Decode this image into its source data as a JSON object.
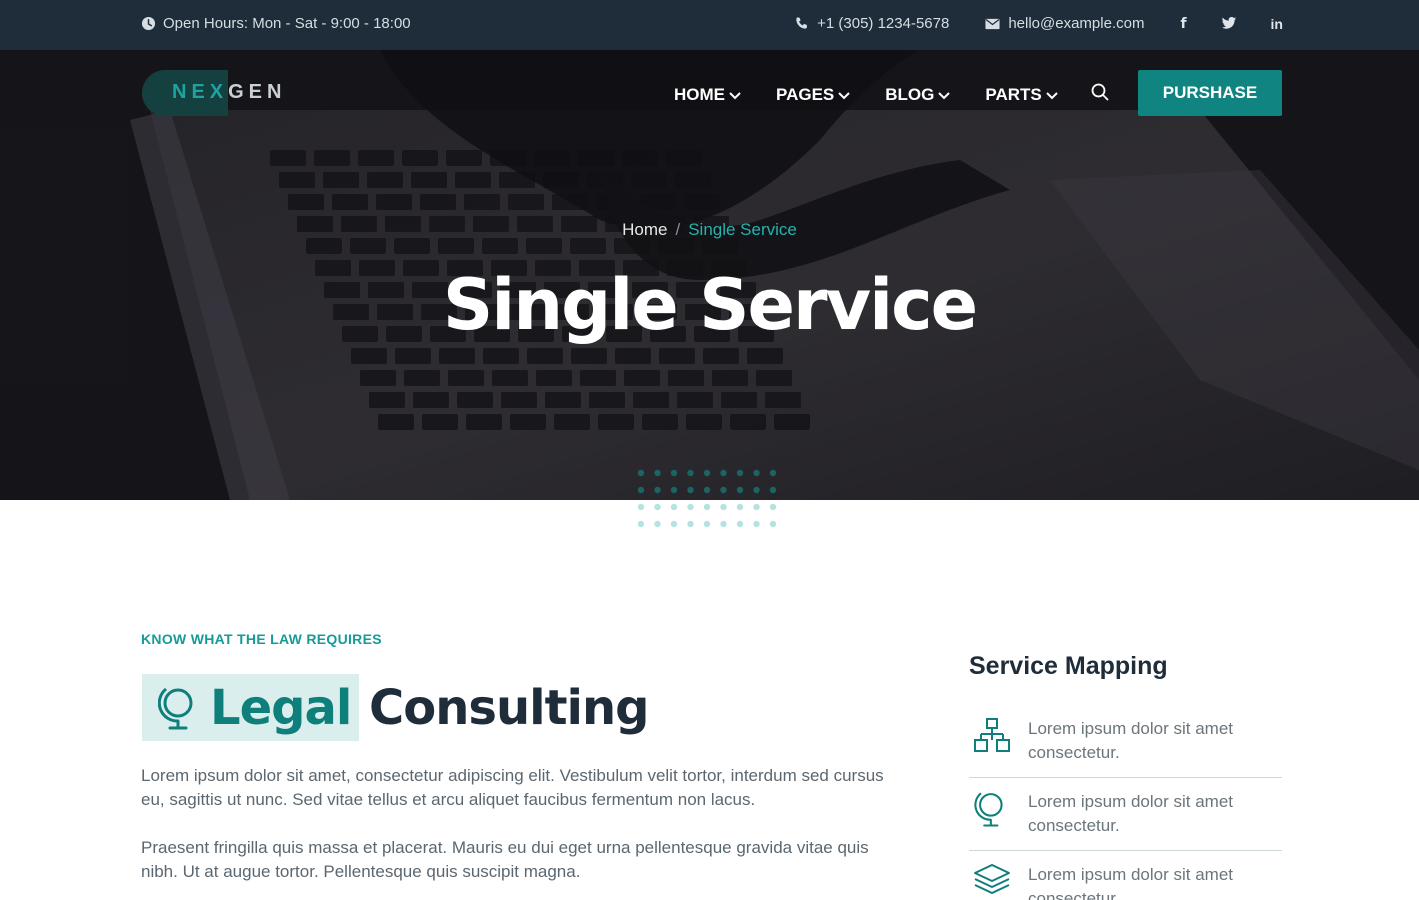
{
  "topbar": {
    "hours": "Open Hours: Mon - Sat - 9:00 - 18:00",
    "phone": "+1 (305) 1234-5678",
    "email": "hello@example.com",
    "social": [
      "f",
      "twitter-icon",
      "in"
    ]
  },
  "logo": {
    "part1": "NEX",
    "part2": "GEN"
  },
  "nav": {
    "items": [
      {
        "label": "HOME"
      },
      {
        "label": "PAGES"
      },
      {
        "label": "BLOG"
      },
      {
        "label": "PARTS"
      }
    ],
    "button": "PURSHASE"
  },
  "breadcrumb": {
    "home": "Home",
    "separator": "/",
    "current": "Single Service"
  },
  "hero": {
    "title": "Single Service"
  },
  "content": {
    "kicker": "KNOW WHAT THE LAW REQUIRES",
    "heading_highlight": "Legal",
    "heading_rest": "Consulting",
    "paragraph1": "Lorem ipsum dolor sit amet, consectetur adipiscing elit. Vestibulum velit tortor, interdum sed cursus eu, sagittis ut nunc. Sed vitae tellus et arcu aliquet faucibus fermentum non lacus.",
    "paragraph2": "Praesent fringilla quis massa et placerat. Mauris eu dui eget urna pellentesque gravida vitae quis nibh. Ut at augue tortor. Pellentesque quis suscipit magna."
  },
  "sidebar": {
    "title": "Service Mapping",
    "items": [
      {
        "icon": "hierarchy-icon",
        "text": "Lorem ipsum dolor sit amet consectetur."
      },
      {
        "icon": "globe-icon",
        "text": "Lorem ipsum dolor sit amet consectetur."
      },
      {
        "icon": "layers-icon",
        "text": "Lorem ipsum dolor sit amet consectetur."
      }
    ]
  },
  "colors": {
    "accent": "#0f8481",
    "topbar": "#1e2d39",
    "heading": "#1e2d39",
    "highlight_bg": "#dbeeee"
  }
}
